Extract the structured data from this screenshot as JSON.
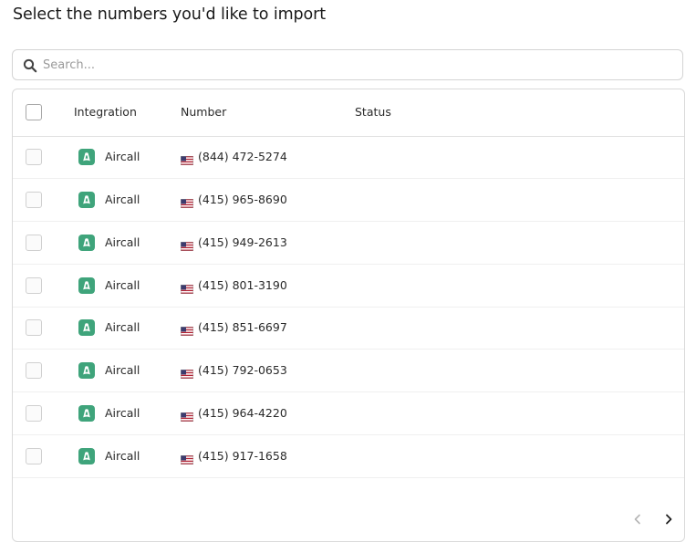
{
  "heading": "Select the numbers you'd like to import",
  "search": {
    "placeholder": "Search...",
    "value": ""
  },
  "table": {
    "columns": [
      "Integration",
      "Number",
      "Status"
    ],
    "rows": [
      {
        "integration": "Aircall",
        "number": "(844) 472-5274",
        "status": ""
      },
      {
        "integration": "Aircall",
        "number": "(415) 965-8690",
        "status": ""
      },
      {
        "integration": "Aircall",
        "number": "(415) 949-2613",
        "status": ""
      },
      {
        "integration": "Aircall",
        "number": "(415) 801-3190",
        "status": ""
      },
      {
        "integration": "Aircall",
        "number": "(415) 851-6697",
        "status": ""
      },
      {
        "integration": "Aircall",
        "number": "(415) 792-0653",
        "status": ""
      },
      {
        "integration": "Aircall",
        "number": "(415) 964-4220",
        "status": ""
      },
      {
        "integration": "Aircall",
        "number": "(415) 917-1658",
        "status": ""
      }
    ]
  },
  "icons": {
    "search": "search-icon",
    "integration_logo": "aircall-logo-icon",
    "flag": "us-flag-icon",
    "prev": "chevron-left-icon",
    "next": "chevron-right-icon"
  },
  "colors": {
    "aircall_green": "#3fa47b",
    "border": "#d9d9d9",
    "pager_disabled": "#b5b5b5",
    "pager_enabled": "#1f1f1f"
  }
}
